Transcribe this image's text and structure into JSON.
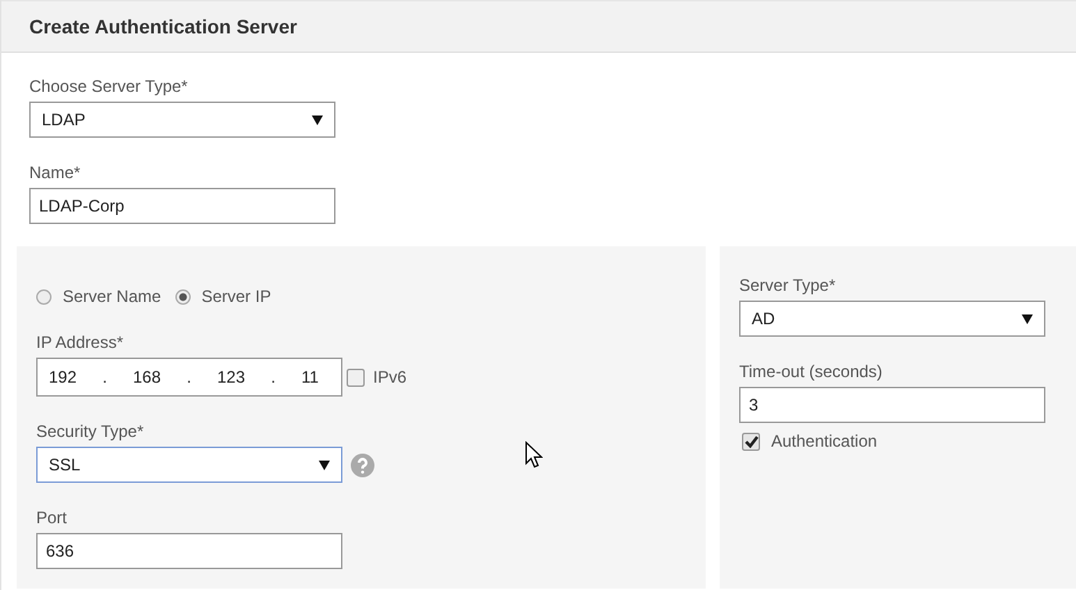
{
  "title": "Create Authentication Server",
  "choose_server_type": {
    "label": "Choose Server Type*",
    "value": "LDAP"
  },
  "name": {
    "label": "Name*",
    "value": "LDAP-Corp"
  },
  "connection": {
    "radios": [
      {
        "label": "Server Name",
        "selected": false
      },
      {
        "label": "Server IP",
        "selected": true
      }
    ],
    "ip_address": {
      "label": "IP Address*",
      "octets": [
        "192",
        "168",
        "123",
        "11"
      ],
      "separator": ".",
      "ipv6": {
        "label": "IPv6",
        "checked": false
      }
    },
    "security_type": {
      "label": "Security Type*",
      "value": "SSL",
      "focused": true
    },
    "port": {
      "label": "Port",
      "value": "636"
    }
  },
  "settings": {
    "server_type": {
      "label": "Server Type*",
      "value": "AD"
    },
    "timeout": {
      "label": "Time-out (seconds)",
      "value": "3"
    },
    "authentication": {
      "label": "Authentication",
      "checked": true
    }
  }
}
